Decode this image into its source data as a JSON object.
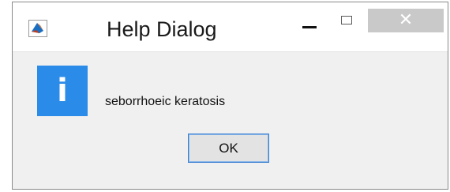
{
  "window": {
    "title": "Help Dialog",
    "app_icon": "matlab-membrane-icon",
    "controls": {
      "minimize_icon": "minimize-icon",
      "maximize_icon": "maximize-icon",
      "close_icon": "close-icon",
      "close_glyph": "✕"
    }
  },
  "dialog": {
    "icon": "info-icon",
    "icon_glyph": "i",
    "message": "seborrhoeic keratosis",
    "ok_label": "OK"
  },
  "colors": {
    "info_blue": "#2b8be8",
    "close_button_bg": "#c9c9c9",
    "dialog_bg": "#f0f0f0",
    "button_border": "#3c7fd1"
  }
}
